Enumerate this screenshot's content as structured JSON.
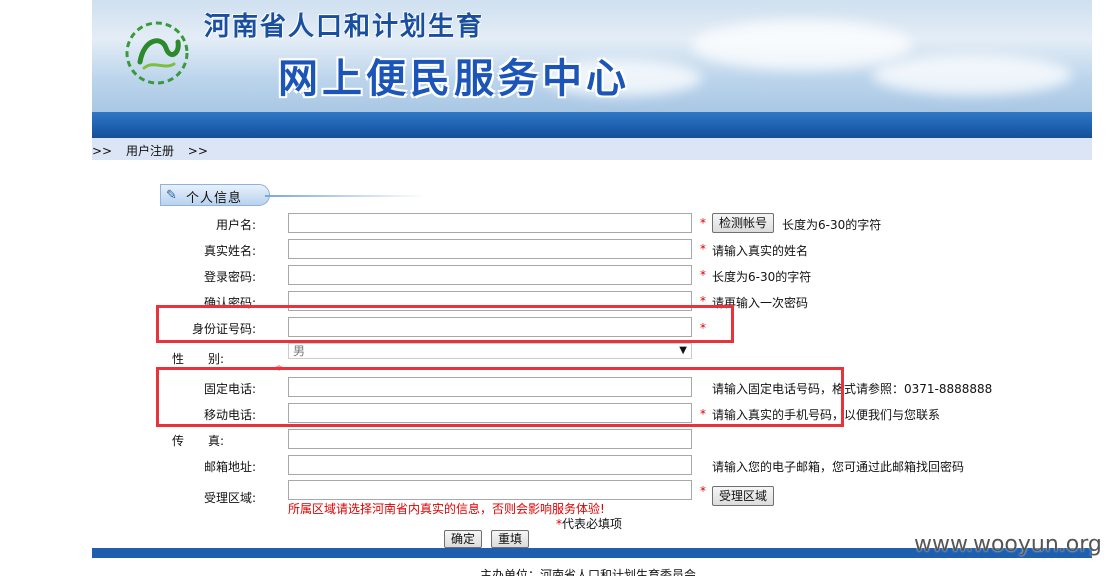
{
  "banner": {
    "title_line1": "河南省人口和计划生育",
    "title_line2": "网上便民服务中心"
  },
  "breadcrumb": {
    "prefix": ">>",
    "current": "用户注册",
    "suffix": ">>"
  },
  "section": {
    "title": "个人信息"
  },
  "form": {
    "username": {
      "label": "用户名:",
      "value": "",
      "required": "*",
      "check_button": "检测帐号",
      "hint": "长度为6-30的字符"
    },
    "realname": {
      "label": "真实姓名:",
      "value": "",
      "required": "*",
      "hint": "请输入真实的姓名"
    },
    "password": {
      "label": "登录密码:",
      "value": "",
      "required": "*",
      "hint": "长度为6-30的字符"
    },
    "confirm_password": {
      "label": "确认密码:",
      "value": "",
      "required": "*",
      "hint": "请再输入一次密码"
    },
    "id_number": {
      "label": "身份证号码:",
      "value": "",
      "required": "*"
    },
    "gender": {
      "label": "性　　别:",
      "selected": "男",
      "required": "*"
    },
    "landline": {
      "label": "固定电话:",
      "value": "",
      "hint": "请输入固定电话号码，格式请参照：0371-8888888"
    },
    "mobile": {
      "label": "移动电话:",
      "value": "",
      "required": "*",
      "hint": "请输入真实的手机号码，以便我们与您联系"
    },
    "fax": {
      "label": "传　　真:",
      "value": ""
    },
    "email": {
      "label": "邮箱地址:",
      "value": "",
      "hint": "请输入您的电子邮箱，您可通过此邮箱找回密码"
    },
    "region": {
      "label": "受理区域:",
      "value": "",
      "required": "*",
      "region_button": "受理区域"
    }
  },
  "warning": "所属区域请选择河南省内真实的信息，否则会影响服务体验!",
  "required_note": {
    "star": "*",
    "text": "代表必填项"
  },
  "buttons": {
    "confirm": "确定",
    "reset": "重填"
  },
  "footer": {
    "text": "主办单位：河南省人口和计划生育委员会"
  },
  "watermark": "www.wooyun.org",
  "colors": {
    "accent_blue": "#1d5fae",
    "required_red": "#dd0000",
    "highlight_red": "#e8333b",
    "crumb_bg": "#dbe5f6"
  }
}
